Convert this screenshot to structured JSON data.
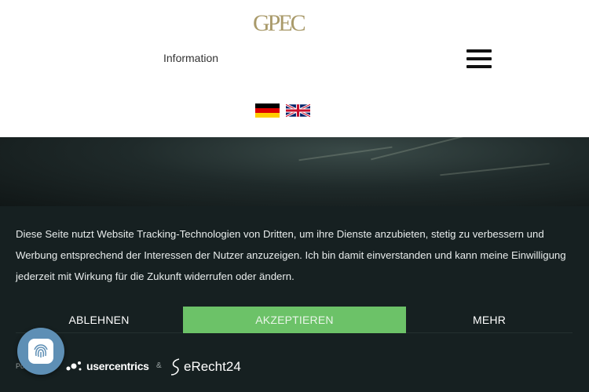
{
  "header": {
    "logo_text": "GPEC",
    "info_link": "Information",
    "menu_icon": "hamburger-menu-icon",
    "flags": [
      {
        "name": "german-flag-icon",
        "lang": "de"
      },
      {
        "name": "english-flag-icon",
        "lang": "en"
      }
    ]
  },
  "consent": {
    "text": "Diese Seite nutzt Website Tracking-Technologien von Dritten, um ihre Dienste anzubieten, stetig zu verbessern und Werbung entsprechend der Interessen der Nutzer anzuzeigen. Ich bin damit einverstanden und kann meine Einwilligung jederzeit mit Wirkung für die Zukunft widerrufen oder ändern.",
    "decline_label": "ABLEHNEN",
    "accept_label": "AKZEPTIEREN",
    "more_label": "MEHR",
    "powered_label": "Po",
    "usercentrics_label": "usercentrics",
    "amp_label": "&",
    "erecht_label": "eRecht24"
  },
  "colors": {
    "banner_bg": "#162021",
    "accept_bg": "#6cc268",
    "fingerprint_bg": "#5e8fb5",
    "logo_gold": "#a99a6a"
  },
  "fingerprint_button_icon": "fingerprint-icon"
}
